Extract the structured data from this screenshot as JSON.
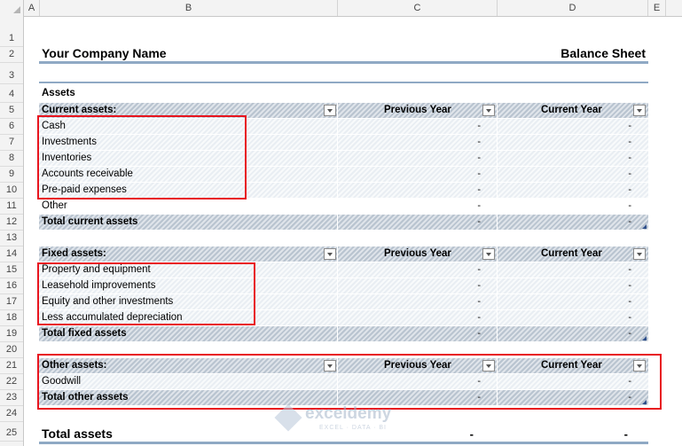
{
  "columns": [
    "A",
    "B",
    "C",
    "D",
    "E"
  ],
  "rows": [
    "1",
    "2",
    "3",
    "4",
    "5",
    "6",
    "7",
    "8",
    "9",
    "10",
    "11",
    "12",
    "13",
    "14",
    "15",
    "16",
    "17",
    "18",
    "19",
    "20",
    "21",
    "22",
    "23",
    "24",
    "25"
  ],
  "header": {
    "company": "Your Company Name",
    "sheet_title": "Balance Sheet"
  },
  "assets_title": "Assets",
  "current": {
    "label": "Current assets:",
    "col_prev": "Previous Year",
    "col_curr": "Current Year",
    "items": [
      "Cash",
      "Investments",
      "Inventories",
      "Accounts receivable",
      "Pre-paid expenses",
      "Other"
    ],
    "total": "Total current assets"
  },
  "fixed": {
    "label": "Fixed assets:",
    "col_prev": "Previous Year",
    "col_curr": "Current Year",
    "items": [
      "Property and equipment",
      "Leasehold improvements",
      "Equity and other investments",
      "Less accumulated depreciation"
    ],
    "total": "Total fixed assets"
  },
  "other": {
    "label": "Other assets:",
    "col_prev": "Previous Year",
    "col_curr": "Current Year",
    "items": [
      "Goodwill"
    ],
    "total": "Total other assets"
  },
  "total_assets": {
    "label": "Total assets",
    "prev": "-",
    "curr": "-"
  },
  "empty_value": "-",
  "watermark": {
    "name": "exceldemy",
    "tagline": "EXCEL · DATA · BI"
  },
  "colors": {
    "accent_red": "#e8141e",
    "band": "#b9c4d0",
    "rule": "#8fa9c4"
  }
}
